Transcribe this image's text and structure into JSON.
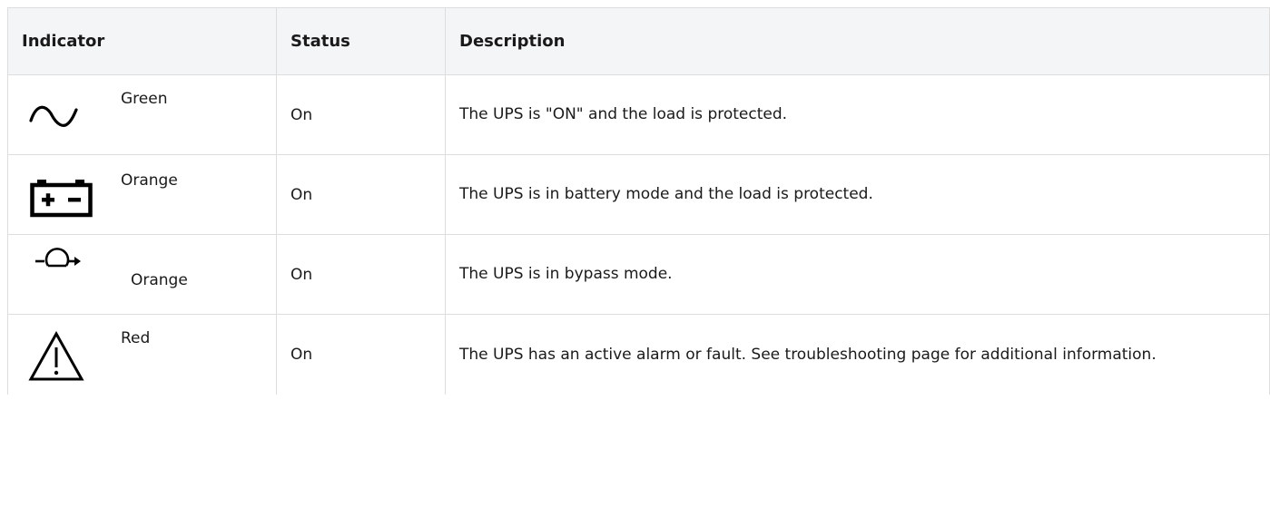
{
  "headers": {
    "indicator": "Indicator",
    "status": "Status",
    "description": "Description"
  },
  "rows": [
    {
      "icon": "sine-wave-icon",
      "color": "Green",
      "status": "On",
      "description": "The UPS is \"ON\" and the load is protected."
    },
    {
      "icon": "battery-icon",
      "color": "Orange",
      "status": "On",
      "description": "The UPS is in battery mode and the load is protected."
    },
    {
      "icon": "bypass-icon",
      "color": "Orange",
      "status": "On",
      "description": "The UPS is in bypass mode."
    },
    {
      "icon": "warning-triangle-icon",
      "color": "Red",
      "status": "On",
      "description": "The UPS has an active alarm or fault. See troubleshooting page for additional information."
    }
  ]
}
